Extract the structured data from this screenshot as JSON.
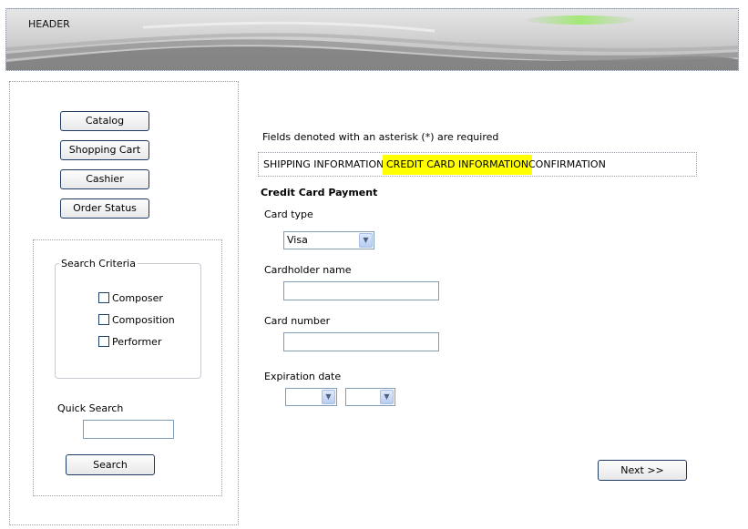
{
  "header": {
    "label": "HEADER"
  },
  "nav": {
    "items": [
      {
        "label": "Catalog"
      },
      {
        "label": "Shopping Cart"
      },
      {
        "label": "Cashier"
      },
      {
        "label": "Order Status"
      }
    ]
  },
  "search": {
    "criteria_title": "Search Criteria",
    "criteria": [
      {
        "label": "Composer",
        "checked": false
      },
      {
        "label": "Composition",
        "checked": false
      },
      {
        "label": "Performer",
        "checked": false
      }
    ],
    "quick_search_label": "Quick Search",
    "quick_search_value": "",
    "button_label": "Search"
  },
  "form": {
    "required_note": "Fields denoted with an asterisk (*) are required",
    "steps": [
      {
        "label": "SHIPPING INFORMATION",
        "active": false
      },
      {
        "label": "CREDIT CARD INFORMATION",
        "active": true
      },
      {
        "label": "CONFIRMATION",
        "active": false
      }
    ],
    "title": "Credit Card Payment",
    "card_type_label": "Card type",
    "card_type_value": "Visa",
    "cardholder_label": "Cardholder name",
    "cardholder_value": "",
    "card_number_label": "Card number",
    "card_number_value": "",
    "expiration_label": "Expiration date",
    "expiration_month": "",
    "expiration_year": "",
    "next_label": "Next >>"
  },
  "colors": {
    "active_step": "#ffff00",
    "button_border": "#1f3b63",
    "input_border": "#7f9db9"
  }
}
